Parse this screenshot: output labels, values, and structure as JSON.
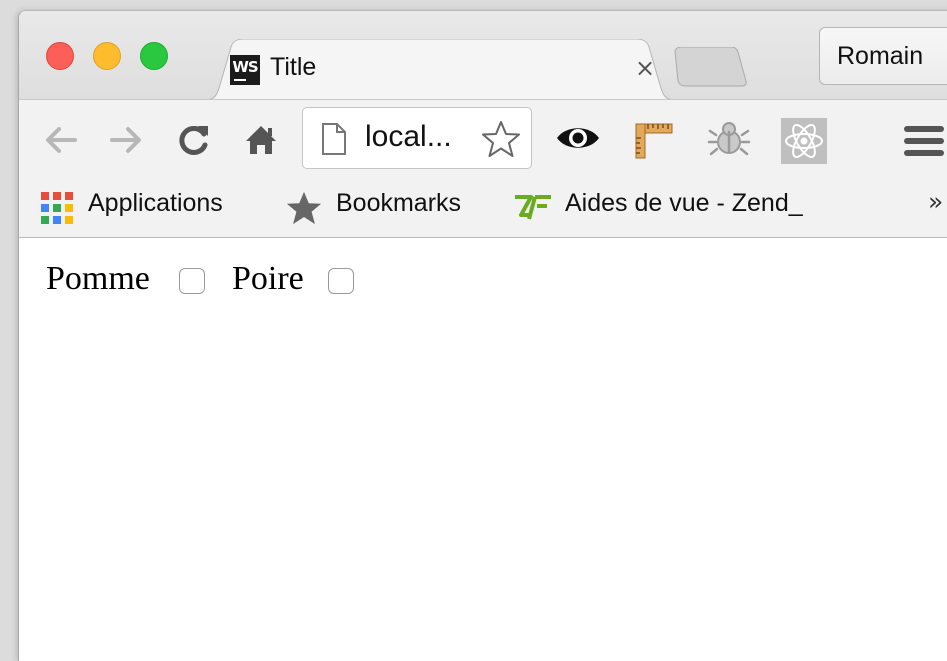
{
  "tab": {
    "favicon_text": "WS",
    "title": "Title",
    "close_symbol": "×"
  },
  "profile": {
    "name": "Romain"
  },
  "toolbar": {
    "url": "local...",
    "icons": [
      "back-icon",
      "forward-icon",
      "reload-icon",
      "home-icon",
      "page-icon",
      "bookmark-star-icon",
      "eye-extension-icon",
      "ruler-extension-icon",
      "bug-extension-icon",
      "react-extension-icon",
      "menu-icon"
    ]
  },
  "bookmarks": {
    "items": [
      {
        "label": "Applications",
        "icon": "apps-grid-icon"
      },
      {
        "label": "Bookmarks",
        "icon": "star-icon"
      },
      {
        "label": "Aides de vue - Zend_",
        "icon": "zend-icon"
      }
    ],
    "more_symbol": "»"
  },
  "content": {
    "fields": [
      {
        "label": "Pomme",
        "checked": false
      },
      {
        "label": "Poire",
        "checked": false
      }
    ]
  },
  "colors": {
    "close": "#fc5f57",
    "minimize": "#fdbc2e",
    "zoom": "#29c840"
  }
}
